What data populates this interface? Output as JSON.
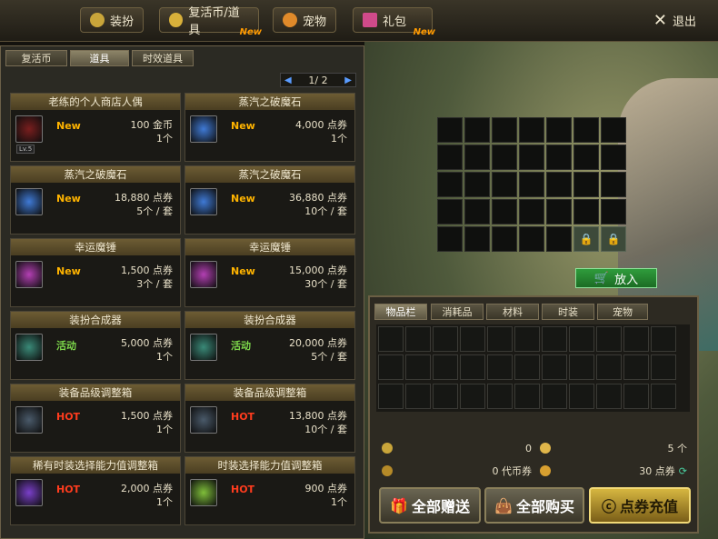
{
  "topnav": {
    "items": [
      {
        "label": "装扮",
        "icon": "trophy-icon",
        "new": ""
      },
      {
        "label": "复活币/道具",
        "icon": "coin-icon",
        "new": "New"
      },
      {
        "label": "宠物",
        "icon": "paw-icon",
        "new": ""
      },
      {
        "label": "礼包",
        "icon": "gift-icon",
        "new": "New"
      }
    ],
    "exit_label": "退出"
  },
  "subtabs": [
    "复活币",
    "道具",
    "时效道具"
  ],
  "pager": {
    "current": "1",
    "total": "2",
    "text": "1/ 2"
  },
  "items": [
    {
      "name": "老练的个人商店人偶",
      "tag": "New",
      "tag_type": "new",
      "price": "100 金币",
      "qty": "1个",
      "icon_color": "#7a1e1e",
      "lv": "Lv.5"
    },
    {
      "name": "蒸汽之破魔石",
      "tag": "New",
      "tag_type": "new",
      "price": "4,000 点券",
      "qty": "1个",
      "icon_color": "#3f7ad6",
      "lv": ""
    },
    {
      "name": "蒸汽之破魔石",
      "tag": "New",
      "tag_type": "new",
      "price": "18,880 点券",
      "qty": "5个 / 套",
      "icon_color": "#3f7ad6",
      "lv": ""
    },
    {
      "name": "蒸汽之破魔石",
      "tag": "New",
      "tag_type": "new",
      "price": "36,880 点券",
      "qty": "10个 / 套",
      "icon_color": "#3f7ad6",
      "lv": ""
    },
    {
      "name": "幸运魔锤",
      "tag": "New",
      "tag_type": "new",
      "price": "1,500 点券",
      "qty": "3个 / 套",
      "icon_color": "#b33fb3",
      "lv": ""
    },
    {
      "name": "幸运魔锤",
      "tag": "New",
      "tag_type": "new",
      "price": "15,000 点券",
      "qty": "30个 / 套",
      "icon_color": "#b33fb3",
      "lv": ""
    },
    {
      "name": "装扮合成器",
      "tag": "活动",
      "tag_type": "act",
      "price": "5,000 点券",
      "qty": "1个",
      "icon_color": "#3a8a78",
      "lv": ""
    },
    {
      "name": "装扮合成器",
      "tag": "活动",
      "tag_type": "act",
      "price": "20,000 点券",
      "qty": "5个 / 套",
      "icon_color": "#3a8a78",
      "lv": ""
    },
    {
      "name": "装备品级调整箱",
      "tag": "HOT",
      "tag_type": "hot",
      "price": "1,500 点券",
      "qty": "1个",
      "icon_color": "#4a5a6a",
      "lv": ""
    },
    {
      "name": "装备品级调整箱",
      "tag": "HOT",
      "tag_type": "hot",
      "price": "13,800 点券",
      "qty": "10个 / 套",
      "icon_color": "#4a5a6a",
      "lv": ""
    },
    {
      "name": "稀有时装选择能力值调整箱",
      "tag": "HOT",
      "tag_type": "hot",
      "price": "2,000 点券",
      "qty": "1个",
      "icon_color": "#7a3fc9",
      "lv": ""
    },
    {
      "name": "时装选择能力值调整箱",
      "tag": "HOT",
      "tag_type": "hot",
      "price": "900 点券",
      "qty": "1个",
      "icon_color": "#7fbf3a",
      "lv": ""
    }
  ],
  "put_in_label": "放入",
  "inv_tabs": [
    "物品栏",
    "消耗品",
    "材料",
    "时装",
    "宠物"
  ],
  "currency": {
    "gold": "0",
    "medal": "5 个",
    "token": "0 代币券",
    "points": "30 点券"
  },
  "buttons": {
    "gift_all": "全部赠送",
    "buy_all": "全部购买",
    "charge": "点券充值"
  },
  "colors": {
    "new": "#ffb400",
    "hot": "#ff3c1e",
    "act": "#7cd64a",
    "accent": "#2f9c3c"
  }
}
